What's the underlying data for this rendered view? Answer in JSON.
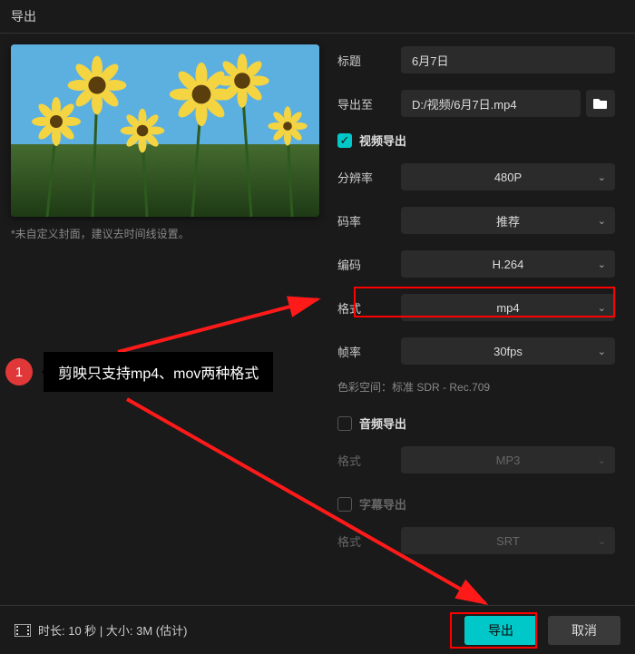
{
  "window_title": "导出",
  "preview_hint": "*未自定义封面，建议去时间线设置。",
  "fields": {
    "title_label": "标题",
    "title_value": "6月7日",
    "export_to_label": "导出至",
    "export_to_value": "D:/视频/6月7日.mp4"
  },
  "sections": {
    "video": {
      "label": "视频导出",
      "checked": true
    },
    "audio": {
      "label": "音频导出",
      "checked": false
    },
    "subtitle": {
      "label": "字幕导出",
      "checked": false
    }
  },
  "video": {
    "resolution_label": "分辨率",
    "resolution_value": "480P",
    "bitrate_label": "码率",
    "bitrate_value": "推荐",
    "codec_label": "编码",
    "codec_value": "H.264",
    "format_label": "格式",
    "format_value": "mp4",
    "fps_label": "帧率",
    "fps_value": "30fps",
    "color_info_label": "色彩空间：",
    "color_info_value": "标准 SDR - Rec.709"
  },
  "audio": {
    "format_label": "格式",
    "format_value": "MP3"
  },
  "subtitle": {
    "format_label": "格式",
    "format_value": "SRT"
  },
  "footer": {
    "info": "时长: 10 秒 | 大小: 3M (估计)",
    "export_btn": "导出",
    "cancel_btn": "取消"
  },
  "annotation": {
    "num": "1",
    "text": "剪映只支持mp4、mov两种格式"
  },
  "icons": {
    "check": "✓",
    "chev": "⌄"
  }
}
